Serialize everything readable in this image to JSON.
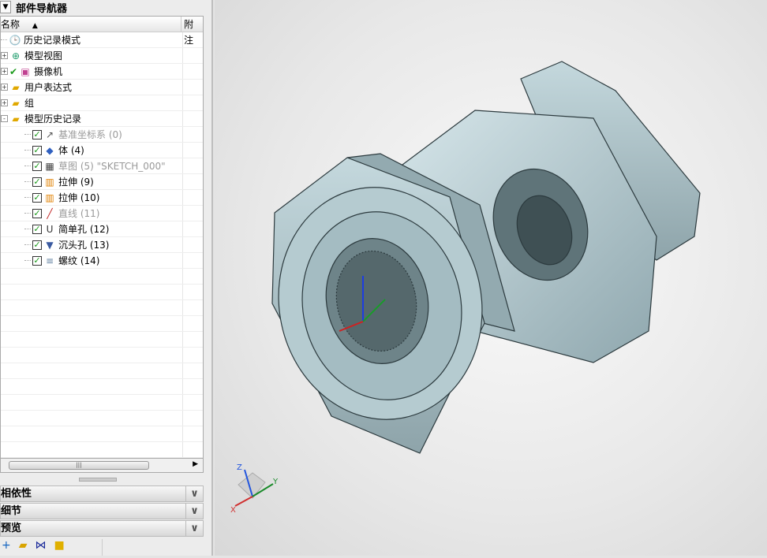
{
  "navigator": {
    "title": "部件导航器",
    "columns": {
      "name": "名称",
      "sort_icon": "sort-ascending-icon",
      "notes": "附注"
    },
    "items": [
      {
        "label": "历史记录模式",
        "icon": "clock-icon",
        "level": 0,
        "dim": false
      },
      {
        "label": "模型视图",
        "icon": "model-view-icon",
        "level": 0,
        "dim": false,
        "expander": "+"
      },
      {
        "label": "摄像机",
        "icon": "camera-icon",
        "level": 0,
        "dim": false,
        "expander": "+",
        "checked": true
      },
      {
        "label": "用户表达式",
        "icon": "folder-icon",
        "level": 0,
        "dim": false,
        "expander": "+"
      },
      {
        "label": "组",
        "icon": "folder-icon",
        "level": 0,
        "dim": false,
        "expander": "+"
      },
      {
        "label": "模型历史记录",
        "icon": "folder-open-icon",
        "level": 0,
        "dim": false,
        "expander": "-"
      },
      {
        "label": "基准坐标系 (0)",
        "icon": "datum-csys-icon",
        "level": 1,
        "dim": true
      },
      {
        "label": "体 (4)",
        "icon": "body-icon",
        "level": 1,
        "dim": false
      },
      {
        "label": "草图 (5) \"SKETCH_000\"",
        "icon": "sketch-icon",
        "level": 1,
        "dim": true
      },
      {
        "label": "拉伸 (9)",
        "icon": "extrude-icon",
        "level": 1,
        "dim": false
      },
      {
        "label": "拉伸 (10)",
        "icon": "extrude-icon",
        "level": 1,
        "dim": false
      },
      {
        "label": "直线 (11)",
        "icon": "line-icon",
        "level": 1,
        "dim": true
      },
      {
        "label": "简单孔 (12)",
        "icon": "simple-hole-icon",
        "level": 1,
        "dim": false
      },
      {
        "label": "沉头孔 (13)",
        "icon": "counterbore-hole-icon",
        "level": 1,
        "dim": false
      },
      {
        "label": "螺纹 (14)",
        "icon": "thread-icon",
        "level": 1,
        "dim": false
      }
    ]
  },
  "sections": [
    {
      "label": "相依性"
    },
    {
      "label": "细节"
    },
    {
      "label": "预览"
    }
  ],
  "axes": {
    "x": "X",
    "y": "Y",
    "z": "Z"
  }
}
